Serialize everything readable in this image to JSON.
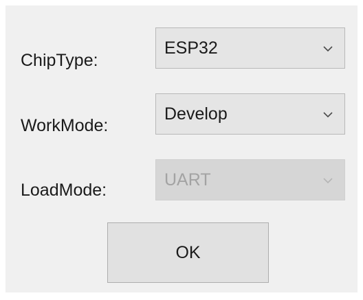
{
  "form": {
    "chip_type": {
      "label": "ChipType:",
      "selected": "ESP32",
      "enabled": true
    },
    "work_mode": {
      "label": "WorkMode:",
      "selected": "Develop",
      "enabled": true
    },
    "load_mode": {
      "label": "LoadMode:",
      "selected": "UART",
      "enabled": false
    }
  },
  "buttons": {
    "ok_label": "OK"
  },
  "icons": {
    "dropdown": "chevron-down-icon"
  },
  "colors": {
    "dialog_background": "#f0f0f0",
    "combo_background": "#e5e5e5",
    "combo_disabled_background": "#d6d6d6",
    "disabled_text": "#a3a3a3",
    "button_background": "#e1e1e1",
    "text": "#1a1a1a"
  }
}
